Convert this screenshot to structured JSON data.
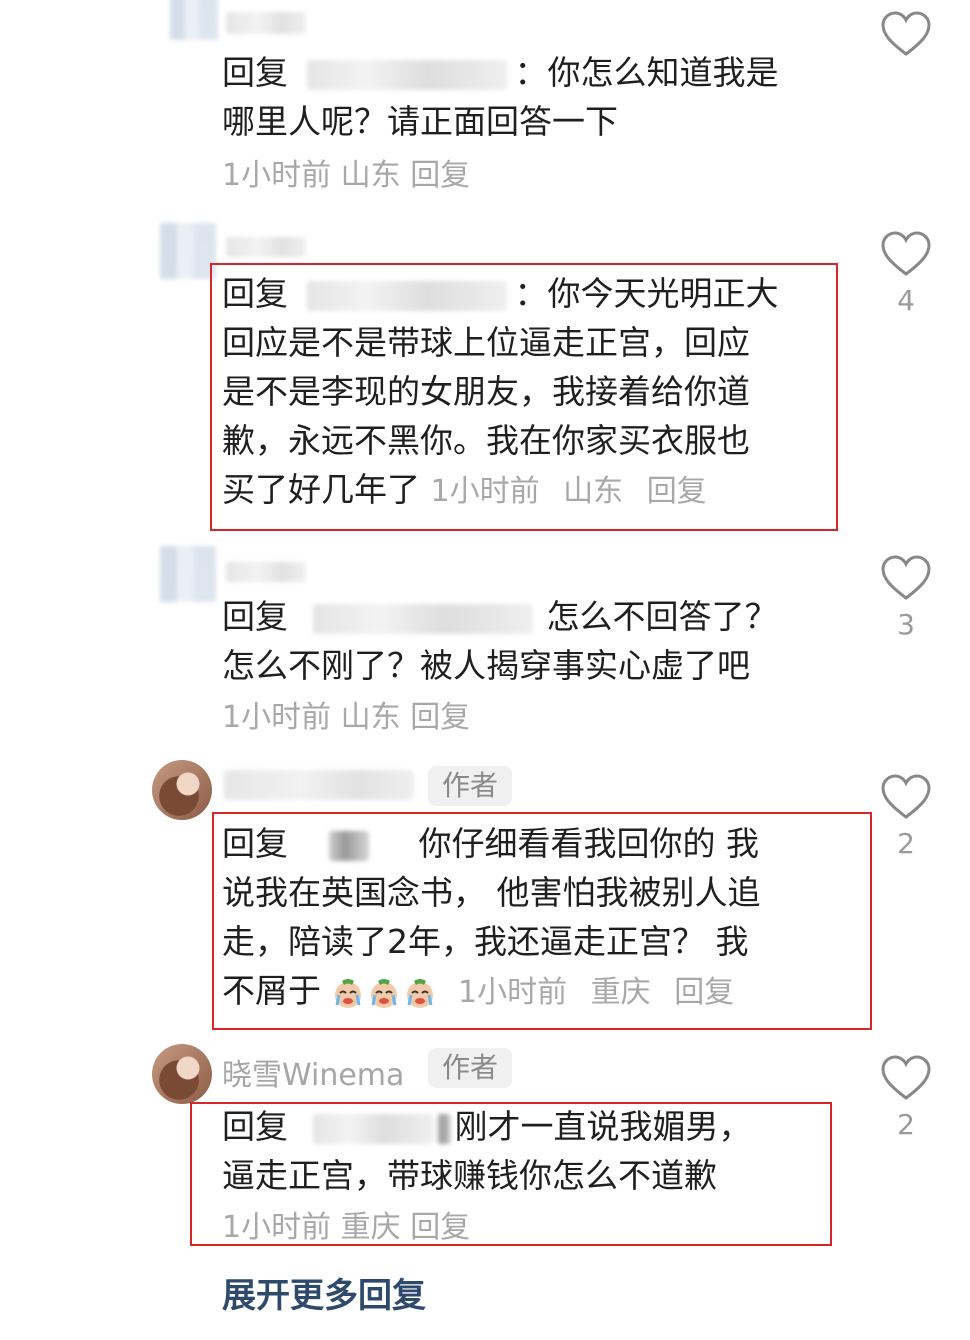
{
  "reply_prefix": "回复",
  "comments": [
    {
      "text_line1": "：你怎么知道我是",
      "text_line2": "哪里人呢？请正面回答一下",
      "time": "1小时前",
      "location": "山东",
      "reply_label": "回复",
      "likes": ""
    },
    {
      "text_after_mask": "：你今天光明正大",
      "lines": [
        "回应是不是带球上位逼走正宫，回应",
        "是不是李现的女朋友，我接着给你道",
        "歉，永远不黑你。我在你家买衣服也",
        "买了好几年了"
      ],
      "time": "1小时前",
      "location": "山东",
      "reply_label": "回复",
      "likes": "4"
    },
    {
      "text_after_mask": "怎么不回答了？",
      "line2": "怎么不刚了？被人揭穿事实心虚了吧",
      "time": "1小时前",
      "location": "山东",
      "reply_label": "回复",
      "likes": "3"
    },
    {
      "author_badge": "作者",
      "text_after_mask": "你仔细看看我回你的 我",
      "lines": [
        "说我在英国念书， 他害怕我被别人追",
        "走，陪读了2年，我还逼走正宫？ 我",
        "不屑于"
      ],
      "emoji_names": [
        "crying-face-emoji",
        "crying-face-emoji",
        "crying-face-emoji"
      ],
      "time": "1小时前",
      "location": "重庆",
      "reply_label": "回复",
      "likes": "2"
    },
    {
      "username": "晓雪Winema",
      "author_badge": "作者",
      "text_after_mask": "刚才一直说我媚男，",
      "line2": "逼走正宫，带球赚钱你怎么不道歉",
      "time": "1小时前",
      "location": "重庆",
      "reply_label": "回复",
      "likes": "2"
    }
  ],
  "expand_more": "展开更多回复",
  "colors": {
    "highlight_box": "#d6262a",
    "meta_text": "#a8a8a8",
    "expand_link": "#2e4a6b"
  }
}
